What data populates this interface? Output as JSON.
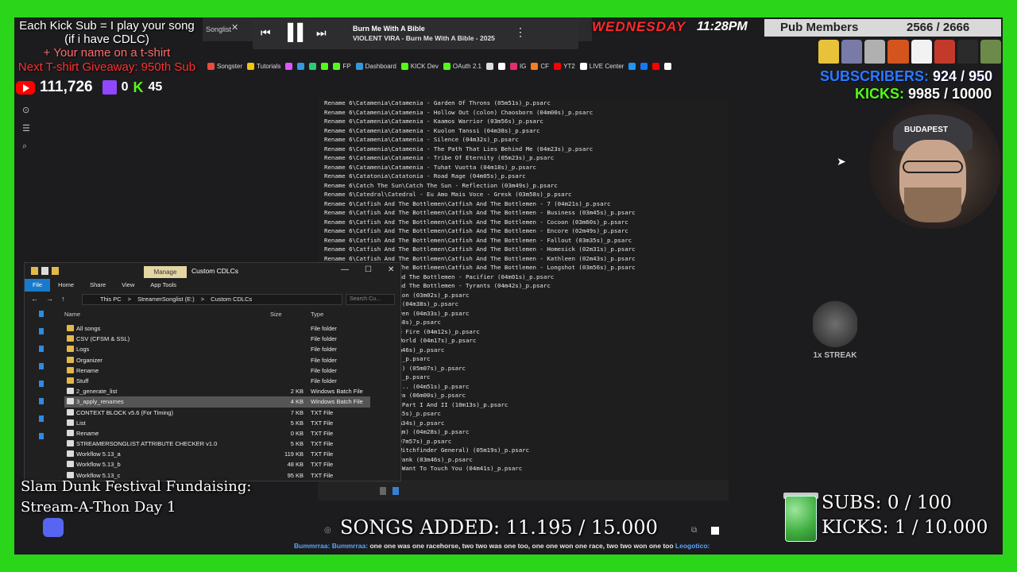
{
  "promo": {
    "line1": "Each Kick Sub = I play your song",
    "line2": "(if i have CDLC)",
    "line3": "+ Your name on a t-shirt",
    "line4": "Next T-shirt Giveaway: 950th Sub"
  },
  "counts": {
    "youtube": "111,726",
    "twitch": "0",
    "kick": "45"
  },
  "browser": {
    "tab_label": "Songlist",
    "tab_close": "✕",
    "bookmarks": [
      {
        "label": "Songster",
        "color": "#e74c3c"
      },
      {
        "label": "Tutorials",
        "color": "#f1c40f"
      },
      {
        "label": "",
        "color": "#e056fd"
      },
      {
        "label": "",
        "color": "#3498db"
      },
      {
        "label": "",
        "color": "#2ecc71"
      },
      {
        "label": "",
        "color": "#53fc18"
      },
      {
        "label": "FP",
        "color": "#53fc18"
      },
      {
        "label": "Dashboard",
        "color": "#3498db"
      },
      {
        "label": "KICK Dev",
        "color": "#53fc18"
      },
      {
        "label": "OAuth 2.1",
        "color": "#53fc18"
      },
      {
        "label": "",
        "color": "#dddddd"
      },
      {
        "label": "",
        "color": "#ffffff"
      },
      {
        "label": "IG",
        "color": "#e1306c"
      },
      {
        "label": "CF",
        "color": "#f38020"
      },
      {
        "label": "YT2",
        "color": "#ff0000"
      },
      {
        "label": "LIVE Center",
        "color": "#ffffff"
      },
      {
        "label": "",
        "color": "#2196f3"
      },
      {
        "label": "",
        "color": "#1877f2"
      },
      {
        "label": "",
        "color": "#ff0000"
      },
      {
        "label": "",
        "color": "#ffffff"
      }
    ]
  },
  "media": {
    "prev": "⏮",
    "pause": "▌▌",
    "next": "⏭",
    "title": "Burn Me With A Bible",
    "subtitle": "VIOLENT VIRA - Burn Me With A Bible - 2025",
    "more": "⋮"
  },
  "status_bar": {
    "day": "WEDNESDAY",
    "time": "11:28PM",
    "pub_label": "Pub Members",
    "pub_value": "2566 / 2666"
  },
  "shirt_colors": [
    "#e8c23a",
    "#7a7aa8",
    "#b0b0b0",
    "#d4541e",
    "#f2f2f2",
    "#c43a2a",
    "#2b2b2b",
    "#6c8a4a"
  ],
  "goals": {
    "subs_label": "SUBSCRIBERS:",
    "subs_value": "924 / 950",
    "kicks_label": "KICKS:",
    "kicks_value": "9985 / 10000"
  },
  "webcam": {
    "cap_text": "BUDAPEST"
  },
  "streak": {
    "label": "1x STREAK"
  },
  "console_lines": [
    "Rename 6\\Catamenia\\Catamenia - Garden Of Throns (05m51s)_p.psarc",
    "Rename 6\\Catamenia\\Catamenia - Hollow Out (colon) Chaosborn (04m00s)_p.psarc",
    "Rename 6\\Catamenia\\Catamenia - Kaamos Warrior (03m56s)_p.psarc",
    "Rename 6\\Catamenia\\Catamenia - Kuolon Tanssi (04m38s)_p.psarc",
    "Rename 6\\Catamenia\\Catamenia - Silence (04m32s)_p.psarc",
    "Rename 6\\Catamenia\\Catamenia - The Path That Lies Behind Me (04m23s)_p.psarc",
    "Rename 6\\Catamenia\\Catamenia - Tribe Of Eternity (05m23s)_p.psarc",
    "Rename 6\\Catamenia\\Catamenia - Tuhat Vuotta (04m18s)_p.psarc",
    "Rename 6\\Catatonia\\Catatonia - Road Rage (04m05s)_p.psarc",
    "Rename 6\\Catch The Sun\\Catch The Sun - Reflection (03m49s)_p.psarc",
    "Rename 6\\Catedral\\Catedral - Eu Amo Mais Voce - Gresk (03m58s)_p.psarc",
    "Rename 6\\Catfish And The Bottlemen\\Catfish And The Bottlemen - 7 (04m21s)_p.psarc",
    "Rename 6\\Catfish And The Bottlemen\\Catfish And The Bottlemen - Business (03m45s)_p.psarc",
    "Rename 6\\Catfish And The Bottlemen\\Catfish And The Bottlemen - Cocoon (03m60s)_p.psarc",
    "Rename 6\\Catfish And The Bottlemen\\Catfish And The Bottlemen - Encore (02m49s)_p.psarc",
    "Rename 6\\Catfish And The Bottlemen\\Catfish And The Bottlemen - Fallout (03m35s)_p.psarc",
    "Rename 6\\Catfish And The Bottlemen\\Catfish And The Bottlemen - Homesick (02m31s)_p.psarc",
    "Rename 6\\Catfish And The Bottlemen\\Catfish And The Bottlemen - Kathleen (02m43s)_p.psarc",
    "Rename 6\\Catfish And The Bottlemen\\Catfish And The Bottlemen - Longshot (03m56s)_p.psarc",
    "            e Bottlemen\\Catfish And The Bottlemen - Pacifier (04m01s)_p.psarc",
    "            e Bottlemen\\Catfish And The Bottlemen - Tyrants (04m42s)_p.psarc",
    "            arsis - ...Into Oblivion (03m02s)_p.psarc",
    "            arsis - Ballada Zemli (04m38s)_p.psarc",
    "            arsis - Chosen By Heaven (04m33s)_p.psarc",
    "            arsis - Crusader (04m58s)_p.psarc",
    "            arsis - Dancing In The Fire (04m12s)_p.psarc",
    "            arsis - Heart Of The World (04m17s)_p.psarc",
    "            arsis - Hold Fast (03m46s)_p.psarc",
    "            arsis - Imago (03m53s)_p.psarc",
    "            arsis - Kryl'ya (Wings) (05m07s)_p.psarc",
    "            arsis - Madre (04m15s)_p.psarc",
    "            arsis - Silence Flows... (04m51s)_p.psarc",
    "            arsis - Simfoniya Ognya (06m00s)_p.psarc",
    "            arsis - Taedium Vitae Part I And II (10m13s)_p.psarc",
    "            arsis - Talisman (03m45s)_p.psarc",
    "            arsis - Uvertyura (02m34s)_p.psarc",
    "            arsis - Who Are You (qm) (04m28s)_p.psarc",
    "            edral - Ebony Tears (07m57s)_p.psarc",
    "            edral - Hopkins (The Witchfinder General) (05m19s)_p.psarc",
    "            l\\Catherine Wheel - Crank (03m46s)_p.psarc",
    "            l\\Catherine Wheel - I Want To Touch You (04m41s)_p.psarc"
  ],
  "explorer": {
    "manage": "Manage",
    "title": "Custom CDLCs",
    "minimize": "—",
    "maximize": "☐",
    "close": "✕",
    "tabs": {
      "file": "File",
      "home": "Home",
      "share": "Share",
      "view": "View",
      "app_tools": "App Tools"
    },
    "crumbs": [
      "This PC",
      ">",
      "StreamerSonglist (E:)",
      ">",
      "Custom CDLCs"
    ],
    "search_placeholder": "Search Cu...",
    "columns": {
      "name": "Name",
      "size": "Size",
      "type": "Type"
    },
    "rows": [
      {
        "name": "All songs",
        "size": "",
        "type": "File folder",
        "folder": true
      },
      {
        "name": "CSV (CFSM & SSL)",
        "size": "",
        "type": "File folder",
        "folder": true
      },
      {
        "name": "Logs",
        "size": "",
        "type": "File folder",
        "folder": true
      },
      {
        "name": "Organizer",
        "size": "",
        "type": "File folder",
        "folder": true
      },
      {
        "name": "Rename",
        "size": "",
        "type": "File folder",
        "folder": true
      },
      {
        "name": "Stuff",
        "size": "",
        "type": "File folder",
        "folder": true
      },
      {
        "name": "2_generate_list",
        "size": "2 KB",
        "type": "Windows Batch File",
        "folder": false
      },
      {
        "name": "3_apply_renames",
        "size": "4 KB",
        "type": "Windows Batch File",
        "folder": false,
        "selected": true
      },
      {
        "name": "CONTEXT BLOCK v5.6 (For Timing)",
        "size": "7 KB",
        "type": "TXT File",
        "folder": false
      },
      {
        "name": "List",
        "size": "5 KB",
        "type": "TXT File",
        "folder": false
      },
      {
        "name": "Rename",
        "size": "0 KB",
        "type": "TXT File",
        "folder": false
      },
      {
        "name": "STREAMERSONGLIST ATTRIBUTE CHECKER v1.0",
        "size": "5 KB",
        "type": "TXT File",
        "folder": false
      },
      {
        "name": "Workflow 5.13_a",
        "size": "119 KB",
        "type": "TXT File",
        "folder": false
      },
      {
        "name": "Workflow 5.13_b",
        "size": "48 KB",
        "type": "TXT File",
        "folder": false
      },
      {
        "name": "Workflow 5.13_c",
        "size": "95 KB",
        "type": "TXT File",
        "folder": false
      }
    ]
  },
  "bottom": {
    "slam_line1": "Slam Dunk Festival Fundaising:",
    "slam_line2": "Stream-A-Thon Day 1",
    "songs_added": "SONGS ADDED: 11.195 / 15.000",
    "subs": "SUBS:  0 / 100",
    "kicks": "KICKS: 1 / 10.000",
    "ticker_user1": "Bummrraa:",
    "ticker_user2": "Bummrraa:",
    "ticker_text": " one one was one racehorse, two two was one too, one one won one race, two two won one too ",
    "ticker_user3": "Leogotico:"
  },
  "side_icons": [
    "⊙",
    "☰",
    "⌕"
  ]
}
